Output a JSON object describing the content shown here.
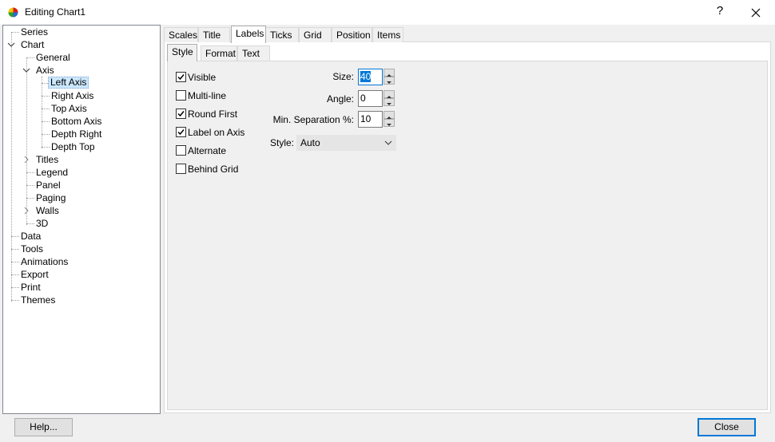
{
  "window": {
    "title": "Editing Chart1",
    "help_glyph": "?"
  },
  "tree": {
    "series": "Series",
    "chart": "Chart",
    "general": "General",
    "axis": "Axis",
    "left_axis": "Left Axis",
    "right_axis": "Right Axis",
    "top_axis": "Top Axis",
    "bottom_axis": "Bottom Axis",
    "depth_right": "Depth Right",
    "depth_top": "Depth Top",
    "titles": "Titles",
    "legend": "Legend",
    "panel": "Panel",
    "paging": "Paging",
    "walls": "Walls",
    "three_d": "3D",
    "data": "Data",
    "tools": "Tools",
    "animations": "Animations",
    "export": "Export",
    "print": "Print",
    "themes": "Themes"
  },
  "outer_tabs": [
    "Scales",
    "Title",
    "Labels",
    "Ticks",
    "Grid",
    "Position",
    "Items"
  ],
  "inner_tabs": [
    "Style",
    "Format",
    "Text"
  ],
  "checkboxes": {
    "visible": {
      "label": "Visible",
      "checked": true
    },
    "multiline": {
      "label": "Multi-line",
      "checked": false
    },
    "round_first": {
      "label": "Round First",
      "checked": true
    },
    "label_on_axis": {
      "label": "Label on Axis",
      "checked": true
    },
    "alternate": {
      "label": "Alternate",
      "checked": false
    },
    "behind_grid": {
      "label": "Behind Grid",
      "checked": false
    }
  },
  "fields": {
    "size_label": "Size:",
    "size_value": "40",
    "angle_label": "Angle:",
    "angle_value": "0",
    "min_sep_label": "Min. Separation %:",
    "min_sep_value": "10",
    "style_label": "Style:",
    "style_value": "Auto"
  },
  "buttons": {
    "help": "Help...",
    "close": "Close"
  }
}
